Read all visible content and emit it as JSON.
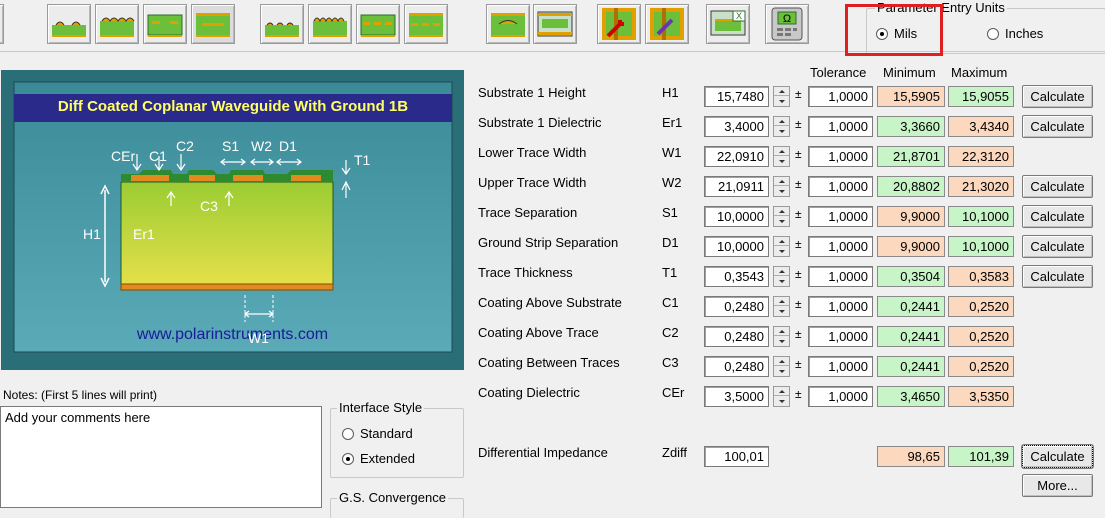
{
  "toolbar": {
    "icons": [
      "edge-coupled-icon",
      "coated-microstrip-icon",
      "embedded-microstrip-icon",
      "offset-stripline-icon",
      "surface-coplanar-icon",
      "coated-coplanar-icon",
      "embedded-coplanar-icon",
      "coplanar-ground-icon",
      "broadside-stripline-icon",
      "dual-stripline-icon",
      "lossless-calc-icon",
      "lossy-calc-icon",
      "export-excel-icon",
      "goal-seek-icon"
    ]
  },
  "units": {
    "group_title": "Parameter Entry Units",
    "mils_label": "Mils",
    "inches_label": "Inches",
    "selected": "Mils"
  },
  "diagram": {
    "title": "Diff Coated Coplanar Waveguide With Ground 1B",
    "url": "www.polarinstruments.com",
    "labels": {
      "cer": "CEr",
      "c1": "C1",
      "c2": "C2",
      "s1": "S1",
      "w2": "W2",
      "d1": "D1",
      "t1": "T1",
      "c3": "C3",
      "h1": "H1",
      "er1": "Er1",
      "w1": "W1"
    }
  },
  "columns": {
    "tolerance": "Tolerance",
    "minimum": "Minimum",
    "maximum": "Maximum"
  },
  "params": [
    {
      "label": "Substrate 1 Height",
      "symbol": "H1",
      "value": "15,7480",
      "tolerance": "1,0000",
      "min": "15,5905",
      "max": "15,9055",
      "calc": "Calculate",
      "min_color": "orange",
      "max_color": "green"
    },
    {
      "label": "Substrate 1 Dielectric",
      "symbol": "Er1",
      "value": "3,4000",
      "tolerance": "1,0000",
      "min": "3,3660",
      "max": "3,4340",
      "calc": "Calculate",
      "min_color": "green",
      "max_color": "orange"
    },
    {
      "label": "Lower Trace Width",
      "symbol": "W1",
      "value": "22,0910",
      "tolerance": "1,0000",
      "min": "21,8701",
      "max": "22,3120",
      "calc": "",
      "min_color": "green",
      "max_color": "orange"
    },
    {
      "label": "Upper Trace Width",
      "symbol": "W2",
      "value": "21,0911",
      "tolerance": "1,0000",
      "min": "20,8802",
      "max": "21,3020",
      "calc": "Calculate",
      "min_color": "green",
      "max_color": "orange"
    },
    {
      "label": "Trace Separation",
      "symbol": "S1",
      "value": "10,0000",
      "tolerance": "1,0000",
      "min": "9,9000",
      "max": "10,1000",
      "calc": "Calculate",
      "min_color": "orange",
      "max_color": "green"
    },
    {
      "label": "Ground Strip Separation",
      "symbol": "D1",
      "value": "10,0000",
      "tolerance": "1,0000",
      "min": "9,9000",
      "max": "10,1000",
      "calc": "Calculate",
      "min_color": "orange",
      "max_color": "green"
    },
    {
      "label": "Trace Thickness",
      "symbol": "T1",
      "value": "0,3543",
      "tolerance": "1,0000",
      "min": "0,3504",
      "max": "0,3583",
      "calc": "Calculate",
      "min_color": "green",
      "max_color": "orange"
    },
    {
      "label": "Coating Above Substrate",
      "symbol": "C1",
      "value": "0,2480",
      "tolerance": "1,0000",
      "min": "0,2441",
      "max": "0,2520",
      "calc": "",
      "min_color": "green",
      "max_color": "orange"
    },
    {
      "label": "Coating Above Trace",
      "symbol": "C2",
      "value": "0,2480",
      "tolerance": "1,0000",
      "min": "0,2441",
      "max": "0,2520",
      "calc": "",
      "min_color": "green",
      "max_color": "orange"
    },
    {
      "label": "Coating Between Traces",
      "symbol": "C3",
      "value": "0,2480",
      "tolerance": "1,0000",
      "min": "0,2441",
      "max": "0,2520",
      "calc": "",
      "min_color": "green",
      "max_color": "orange"
    },
    {
      "label": "Coating Dielectric",
      "symbol": "CEr",
      "value": "3,5000",
      "tolerance": "1,0000",
      "min": "3,4650",
      "max": "3,5350",
      "calc": "",
      "min_color": "green",
      "max_color": "orange"
    }
  ],
  "pm_symbol": "±",
  "impedance": {
    "label": "Differential Impedance",
    "symbol": "Zdiff",
    "value": "100,01",
    "min": "98,65",
    "max": "101,39",
    "calc": "Calculate",
    "more": "More..."
  },
  "notes": {
    "label": "Notes: (First 5 lines will print)",
    "text": "Add your comments here"
  },
  "interface_style": {
    "title": "Interface Style",
    "standard": "Standard",
    "extended": "Extended",
    "selected": "Extended"
  },
  "gs_convergence": {
    "title": "G.S. Convergence"
  },
  "colors": {
    "orange": "#fcd8bf",
    "green": "#c8f5c8",
    "highlight": "#e02020",
    "diagram_bg": "#2a6e78",
    "diagram_title_bg": "#2a2a8a",
    "diagram_title_fg": "#ffff66"
  }
}
